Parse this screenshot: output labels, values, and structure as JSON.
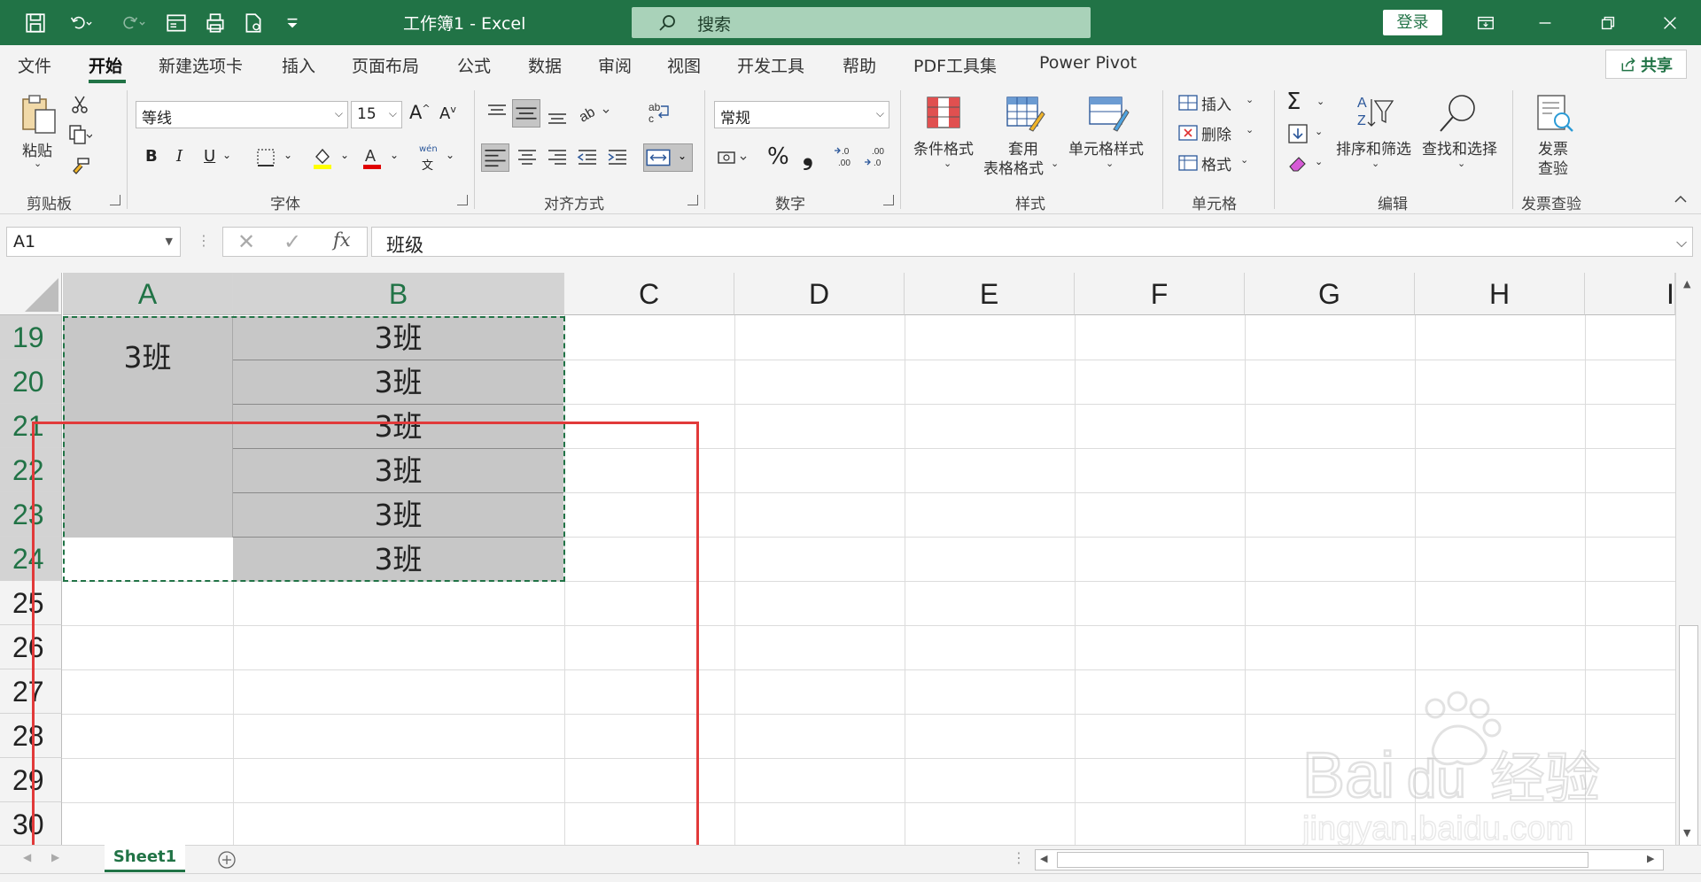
{
  "titlebar": {
    "doc_title": "工作簿1  -  Excel",
    "search_placeholder": "搜索",
    "login_label": "登录"
  },
  "tabs": {
    "items": [
      "文件",
      "开始",
      "新建选项卡",
      "插入",
      "页面布局",
      "公式",
      "数据",
      "审阅",
      "视图",
      "开发工具",
      "帮助",
      "PDF工具集",
      "Power Pivot"
    ],
    "active": "开始",
    "share_label": "共享"
  },
  "ribbon": {
    "clipboard": {
      "label": "剪贴板",
      "paste": "粘贴"
    },
    "font": {
      "label": "字体",
      "name": "等线",
      "size": "15",
      "bold": "B",
      "italic": "I",
      "underline": "U",
      "phonetic_top": "wén",
      "phonetic_bottom": "文"
    },
    "align": {
      "label": "对齐方式"
    },
    "number": {
      "label": "数字",
      "format": "常规",
      "percent": "%",
      "comma": "❟"
    },
    "styles": {
      "label": "样式",
      "conditional": "条件格式",
      "table_line1": "套用",
      "table_line2": "表格格式",
      "cell_styles": "单元格样式"
    },
    "cells": {
      "label": "单元格",
      "insert": "插入",
      "delete": "删除",
      "format": "格式"
    },
    "editing": {
      "label": "编辑",
      "sort": "排序和筛选",
      "find": "查找和选择"
    },
    "invoice": {
      "label": "发票查验",
      "line1": "发票",
      "line2": "查验"
    }
  },
  "formula_bar": {
    "name_box": "A1",
    "formula": "班级",
    "fx": "fx"
  },
  "grid": {
    "columns": [
      "A",
      "B",
      "C",
      "D",
      "E",
      "F",
      "G",
      "H",
      "I"
    ],
    "rows": [
      "19",
      "20",
      "21",
      "22",
      "23",
      "24",
      "25",
      "26",
      "27",
      "28",
      "29",
      "30"
    ],
    "merged_a": "3班",
    "b_values": [
      "3班",
      "3班",
      "3班",
      "3班",
      "3班",
      "3班"
    ]
  },
  "sheets": {
    "tabs": [
      "Sheet1"
    ]
  },
  "watermark": {
    "line1": "Baidu经验",
    "line2": "jingyan.baidu.com"
  }
}
